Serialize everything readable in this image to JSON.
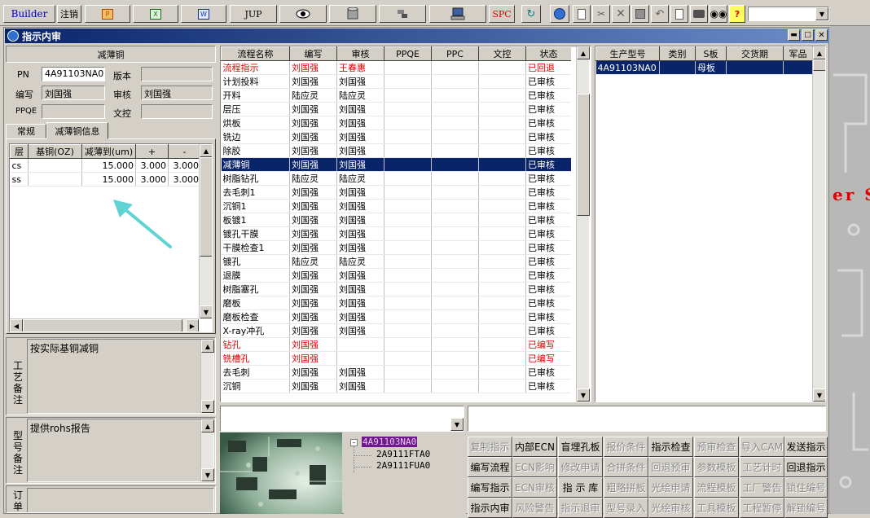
{
  "toolbar": {
    "builder_label": "Builder",
    "logout_label": "注销",
    "jup_label": "JUP",
    "spc_label": "SPC",
    "help_label": "?"
  },
  "window": {
    "title": "指示内审"
  },
  "left": {
    "group_title": "减薄铜",
    "pn_label": "PN",
    "pn_value": "4A91103NA0",
    "version_label": "版本",
    "version_value": "",
    "writer_label": "编写",
    "writer_value": "刘国强",
    "review_label": "审核",
    "review_value": "刘国强",
    "ppqe_label": "PPQE",
    "ppqe_value": "",
    "doc_label": "文控",
    "doc_value": "",
    "tabs": [
      "常规",
      "减薄铜信息"
    ],
    "layer_table": {
      "headers": [
        "层",
        "基铜(OZ)",
        "减薄到(um)",
        "+",
        "-"
      ],
      "rows": [
        [
          "cs",
          "",
          "15.000",
          "3.000",
          "3.000"
        ],
        [
          "ss",
          "",
          "15.000",
          "3.000",
          "3.000"
        ]
      ]
    },
    "process_note_label": "工艺备注",
    "process_note_value": "按实际基铜减铜",
    "type_note_label": "型号备注",
    "type_note_value": "提供rohs报告",
    "order_note_label": "订单备"
  },
  "process_table": {
    "headers": [
      "流程名称",
      "编写",
      "审核",
      "PPQE",
      "PPC",
      "文控",
      "状态"
    ],
    "rows": [
      {
        "name": "流程指示",
        "writer": "刘国强",
        "reviewer": "王春惠",
        "ppqe": "",
        "ppc": "",
        "doc": "",
        "status": "已回退",
        "color": "red"
      },
      {
        "name": "计划投料",
        "writer": "刘国强",
        "reviewer": "刘国强",
        "ppqe": "",
        "ppc": "",
        "doc": "",
        "status": "已审核",
        "color": ""
      },
      {
        "name": "开料",
        "writer": "陆应灵",
        "reviewer": "陆应灵",
        "ppqe": "",
        "ppc": "",
        "doc": "",
        "status": "已审核",
        "color": ""
      },
      {
        "name": "层压",
        "writer": "刘国强",
        "reviewer": "刘国强",
        "ppqe": "",
        "ppc": "",
        "doc": "",
        "status": "已审核",
        "color": ""
      },
      {
        "name": "烘板",
        "writer": "刘国强",
        "reviewer": "刘国强",
        "ppqe": "",
        "ppc": "",
        "doc": "",
        "status": "已审核",
        "color": ""
      },
      {
        "name": "铣边",
        "writer": "刘国强",
        "reviewer": "刘国强",
        "ppqe": "",
        "ppc": "",
        "doc": "",
        "status": "已审核",
        "color": ""
      },
      {
        "name": "除胶",
        "writer": "刘国强",
        "reviewer": "刘国强",
        "ppqe": "",
        "ppc": "",
        "doc": "",
        "status": "已审核",
        "color": ""
      },
      {
        "name": "减薄铜",
        "writer": "刘国强",
        "reviewer": "刘国强",
        "ppqe": "",
        "ppc": "",
        "doc": "",
        "status": "已审核",
        "color": "",
        "selected": true
      },
      {
        "name": "树脂钻孔",
        "writer": "陆应灵",
        "reviewer": "陆应灵",
        "ppqe": "",
        "ppc": "",
        "doc": "",
        "status": "已审核",
        "color": ""
      },
      {
        "name": "去毛刺1",
        "writer": "刘国强",
        "reviewer": "刘国强",
        "ppqe": "",
        "ppc": "",
        "doc": "",
        "status": "已审核",
        "color": ""
      },
      {
        "name": "沉铜1",
        "writer": "刘国强",
        "reviewer": "刘国强",
        "ppqe": "",
        "ppc": "",
        "doc": "",
        "status": "已审核",
        "color": ""
      },
      {
        "name": "板镀1",
        "writer": "刘国强",
        "reviewer": "刘国强",
        "ppqe": "",
        "ppc": "",
        "doc": "",
        "status": "已审核",
        "color": ""
      },
      {
        "name": "镀孔干膜",
        "writer": "刘国强",
        "reviewer": "刘国强",
        "ppqe": "",
        "ppc": "",
        "doc": "",
        "status": "已审核",
        "color": ""
      },
      {
        "name": "干膜检查1",
        "writer": "刘国强",
        "reviewer": "刘国强",
        "ppqe": "",
        "ppc": "",
        "doc": "",
        "status": "已审核",
        "color": ""
      },
      {
        "name": "镀孔",
        "writer": "陆应灵",
        "reviewer": "陆应灵",
        "ppqe": "",
        "ppc": "",
        "doc": "",
        "status": "已审核",
        "color": ""
      },
      {
        "name": "退膜",
        "writer": "刘国强",
        "reviewer": "刘国强",
        "ppqe": "",
        "ppc": "",
        "doc": "",
        "status": "已审核",
        "color": ""
      },
      {
        "name": "树脂塞孔",
        "writer": "刘国强",
        "reviewer": "刘国强",
        "ppqe": "",
        "ppc": "",
        "doc": "",
        "status": "已审核",
        "color": ""
      },
      {
        "name": "磨板",
        "writer": "刘国强",
        "reviewer": "刘国强",
        "ppqe": "",
        "ppc": "",
        "doc": "",
        "status": "已审核",
        "color": ""
      },
      {
        "name": "磨板检查",
        "writer": "刘国强",
        "reviewer": "刘国强",
        "ppqe": "",
        "ppc": "",
        "doc": "",
        "status": "已审核",
        "color": ""
      },
      {
        "name": "X-ray冲孔",
        "writer": "刘国强",
        "reviewer": "刘国强",
        "ppqe": "",
        "ppc": "",
        "doc": "",
        "status": "已审核",
        "color": ""
      },
      {
        "name": "钻孔",
        "writer": "刘国强",
        "reviewer": "",
        "ppqe": "",
        "ppc": "",
        "doc": "",
        "status": "已编写",
        "color": "red"
      },
      {
        "name": "铣槽孔",
        "writer": "刘国强",
        "reviewer": "",
        "ppqe": "",
        "ppc": "",
        "doc": "",
        "status": "已编写",
        "color": "red"
      },
      {
        "name": "去毛刺",
        "writer": "刘国强",
        "reviewer": "刘国强",
        "ppqe": "",
        "ppc": "",
        "doc": "",
        "status": "已审核",
        "color": ""
      },
      {
        "name": "沉铜",
        "writer": "刘国强",
        "reviewer": "刘国强",
        "ppqe": "",
        "ppc": "",
        "doc": "",
        "status": "已审核",
        "color": ""
      }
    ]
  },
  "product_table": {
    "headers": [
      "生产型号",
      "类别",
      "S板",
      "交货期",
      "军品"
    ],
    "rows": [
      [
        "4A91103NA0",
        "",
        "母板",
        "",
        ""
      ]
    ]
  },
  "tree": {
    "root": "4A91103NA0",
    "children": [
      "2A9111FTA0",
      "2A9111FUA0"
    ]
  },
  "actions": [
    [
      {
        "label": "复制指示",
        "enabled": false
      },
      {
        "label": "内部ECN",
        "enabled": true
      },
      {
        "label": "盲埋孔板",
        "enabled": true
      },
      {
        "label": "报价条件",
        "enabled": false
      },
      {
        "label": "指示检查",
        "enabled": true
      },
      {
        "label": "预审检查",
        "enabled": false
      },
      {
        "label": "导入CAM",
        "enabled": false
      },
      {
        "label": "发送指示",
        "enabled": true
      }
    ],
    [
      {
        "label": "编写流程",
        "enabled": true
      },
      {
        "label": "ECN影响",
        "enabled": false
      },
      {
        "label": "修改申请",
        "enabled": false
      },
      {
        "label": "合拼条件",
        "enabled": false
      },
      {
        "label": "回退预审",
        "enabled": false
      },
      {
        "label": "参数模板",
        "enabled": false
      },
      {
        "label": "工艺计时",
        "enabled": false
      },
      {
        "label": "回退指示",
        "enabled": true
      }
    ],
    [
      {
        "label": "编写指示",
        "enabled": true
      },
      {
        "label": "ECN审核",
        "enabled": false
      },
      {
        "label": "指 示 库",
        "enabled": true
      },
      {
        "label": "粗略拼板",
        "enabled": false
      },
      {
        "label": "光绘申请",
        "enabled": false
      },
      {
        "label": "流程模板",
        "enabled": false
      },
      {
        "label": "工厂警告",
        "enabled": false
      },
      {
        "label": "锁住编号",
        "enabled": false
      }
    ],
    [
      {
        "label": "指示内审",
        "enabled": true
      },
      {
        "label": "风险警告",
        "enabled": false
      },
      {
        "label": "指示退审",
        "enabled": false
      },
      {
        "label": "型号录入",
        "enabled": false
      },
      {
        "label": "光绘审核",
        "enabled": false
      },
      {
        "label": "工具模板",
        "enabled": false
      },
      {
        "label": "工程暂停",
        "enabled": false
      },
      {
        "label": "解锁编号",
        "enabled": false
      }
    ]
  ],
  "background": {
    "fragment_text": "er S",
    "fragment_color": "#e00000"
  },
  "colors": {
    "title_bar": "#0a246a",
    "selection": "#0a246a",
    "warning_text": "#e00000",
    "annotation_arrow": "#5fd3d3"
  }
}
